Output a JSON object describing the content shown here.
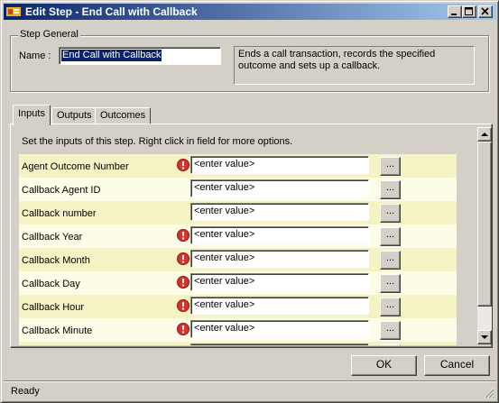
{
  "window": {
    "title": "Edit Step - End Call with Callback",
    "title_bar_color": "#0a246a"
  },
  "step_general": {
    "legend": "Step General",
    "name_label": "Name :",
    "name_value": "End Call with Callback",
    "description": "Ends a call transaction, records the specified outcome and sets up a callback."
  },
  "tabs": [
    {
      "label": "Inputs",
      "active": true
    },
    {
      "label": "Outputs",
      "active": false
    },
    {
      "label": "Outcomes",
      "active": false
    }
  ],
  "inputs": {
    "hint": "Set the inputs of this step.  Right click in field for more options.",
    "browse_label": "...",
    "rows": [
      {
        "label": "Agent Outcome Number",
        "value": "<enter value>",
        "required": true
      },
      {
        "label": "Callback Agent ID",
        "value": "<enter value>",
        "required": false
      },
      {
        "label": "Callback number",
        "value": "<enter value>",
        "required": false
      },
      {
        "label": "Callback Year",
        "value": "<enter value>",
        "required": true
      },
      {
        "label": "Callback Month",
        "value": "<enter value>",
        "required": true
      },
      {
        "label": "Callback Day",
        "value": "<enter value>",
        "required": true
      },
      {
        "label": "Callback Hour",
        "value": "<enter value>",
        "required": true
      },
      {
        "label": "Callback Minute",
        "value": "<enter value>",
        "required": true
      },
      {
        "label": "",
        "value": "",
        "required": false
      }
    ]
  },
  "buttons": {
    "ok": "OK",
    "cancel": "Cancel"
  },
  "status": {
    "text": "Ready"
  },
  "colors": {
    "row_odd": "#f5f3c4",
    "row_even": "#fdfce6",
    "warning": "#d8322a",
    "selection": "#0a246a"
  }
}
